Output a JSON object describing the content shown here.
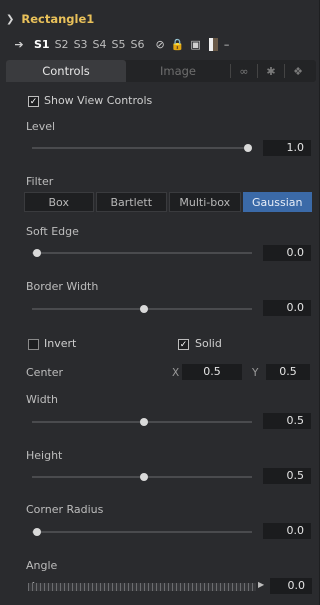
{
  "title": {
    "name": "Rectangle1"
  },
  "versions": [
    "S1",
    "S2",
    "S3",
    "S4",
    "S5",
    "S6"
  ],
  "tabs": {
    "controls": "Controls",
    "image": "Image"
  },
  "show_view_controls": {
    "label": "Show View Controls",
    "checked": true
  },
  "level": {
    "label": "Level",
    "value": "1.0",
    "fraction": 1.0
  },
  "filter": {
    "label": "Filter",
    "options": [
      "Box",
      "Bartlett",
      "Multi-box",
      "Gaussian"
    ],
    "selected": "Gaussian"
  },
  "soft_edge": {
    "label": "Soft Edge",
    "value": "0.0",
    "fraction": 0.0
  },
  "border_width": {
    "label": "Border Width",
    "value": "0.0",
    "fraction": 0.5
  },
  "invert": {
    "label": "Invert",
    "checked": false
  },
  "solid": {
    "label": "Solid",
    "checked": true
  },
  "center": {
    "label": "Center",
    "x_label": "X",
    "x": "0.5",
    "y_label": "Y",
    "y": "0.5"
  },
  "width": {
    "label": "Width",
    "value": "0.5",
    "fraction": 0.5
  },
  "height": {
    "label": "Height",
    "value": "0.5",
    "fraction": 0.5
  },
  "corner_radius": {
    "label": "Corner Radius",
    "value": "0.0",
    "fraction": 0.0
  },
  "angle": {
    "label": "Angle",
    "value": "0.0"
  },
  "colors": {
    "title_accent": "#e9c15a",
    "selected_button": "#3b6aa8"
  }
}
